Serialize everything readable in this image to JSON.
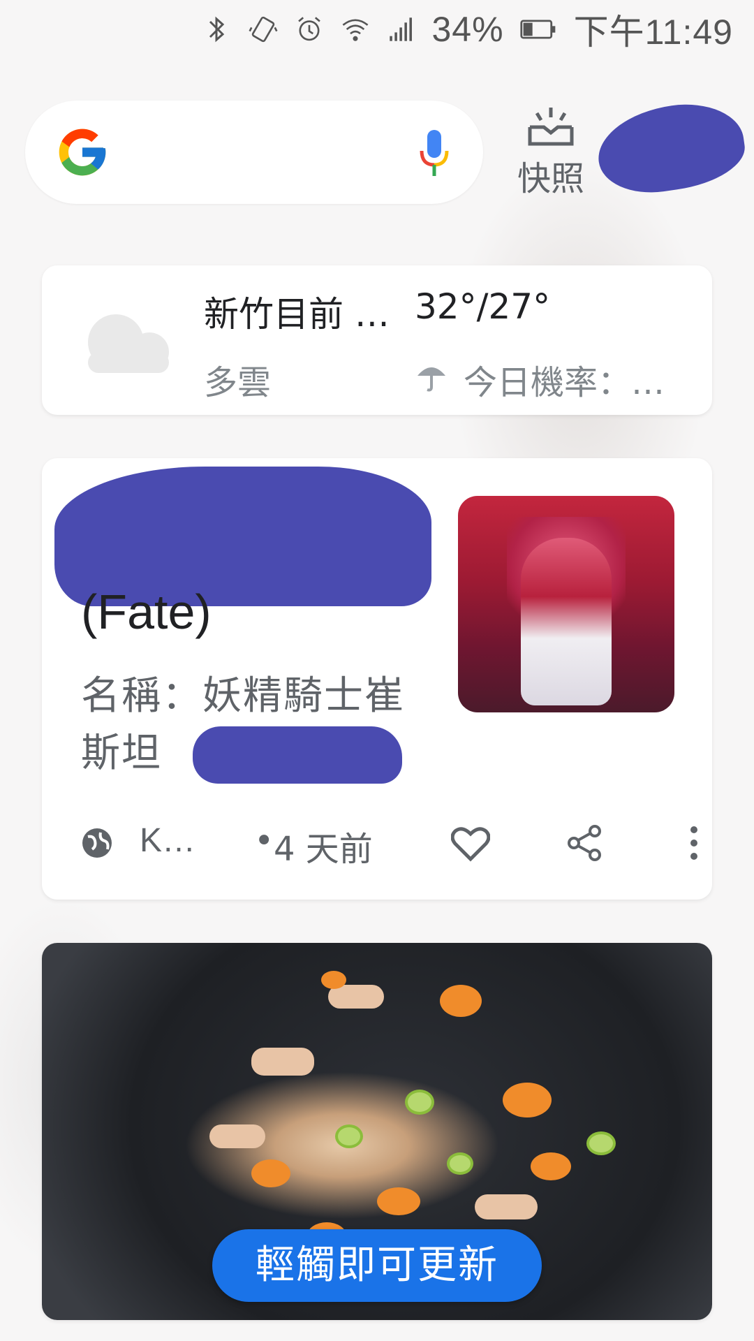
{
  "status_bar": {
    "battery_percent": "34%",
    "time": "下午11:49",
    "icons": [
      "bluetooth-icon",
      "vibrate-icon",
      "alarm-icon",
      "wifi-icon",
      "signal-icon",
      "battery-icon"
    ]
  },
  "search": {
    "logo": "google-g-icon",
    "mic": "mic-icon"
  },
  "snapshot": {
    "label": "快照"
  },
  "weather": {
    "title": "新竹目前 …",
    "temp": "32°/27°",
    "condition": "多雲",
    "rain": "今日機率：…"
  },
  "article": {
    "title": "(Fate)",
    "desc_line1": "名稱：妖精騎士崔",
    "desc_line2": "斯坦",
    "desc_tail": ".",
    "source": "K…",
    "dot": "•",
    "age": "4 天前"
  },
  "refresh": {
    "label": "輕觸即可更新"
  },
  "colors": {
    "accent": "#1a73e8",
    "redaction": "#4a4bb0"
  }
}
